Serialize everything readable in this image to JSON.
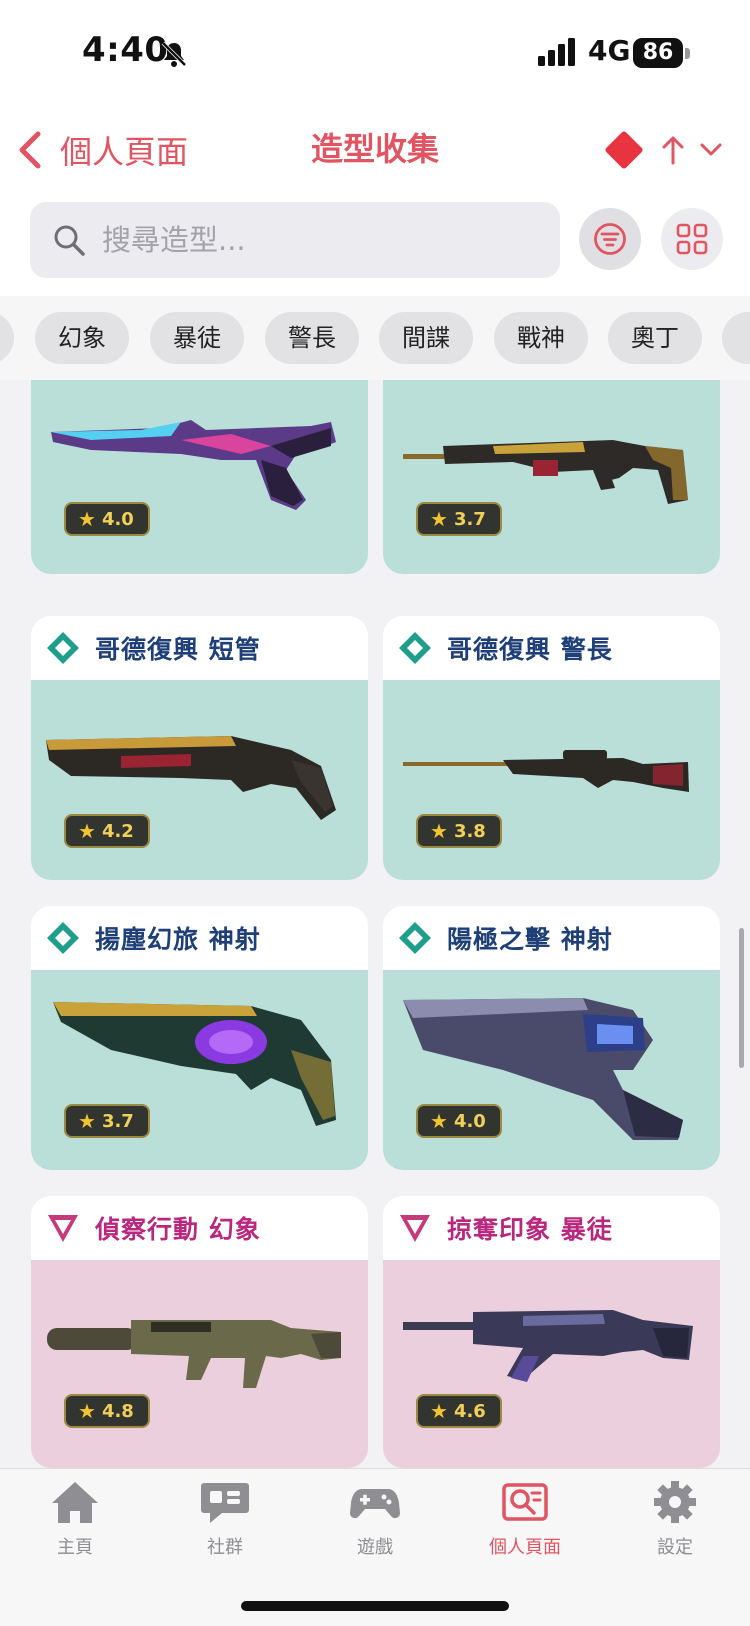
{
  "status_bar": {
    "time": "4:40",
    "network": "4G",
    "battery": "86"
  },
  "header": {
    "back_label": "個人頁面",
    "title": "造型收集"
  },
  "search": {
    "placeholder": "搜尋造型..."
  },
  "chips": [
    "幻象",
    "暴徒",
    "警長",
    "間諜",
    "戰神",
    "奧丁"
  ],
  "cards": [
    {
      "name": "",
      "rating": "4.0",
      "tier": "exclusive",
      "bg": "#b9dfd8"
    },
    {
      "name": "",
      "rating": "3.7",
      "tier": "exclusive",
      "bg": "#b9dfd8"
    },
    {
      "name": "哥德復興 短管",
      "rating": "4.2",
      "tier": "exclusive",
      "bg": "#b9dfd8"
    },
    {
      "name": "哥德復興 警長",
      "rating": "3.8",
      "tier": "exclusive",
      "bg": "#b9dfd8"
    },
    {
      "name": "揚塵幻旅 神射",
      "rating": "3.7",
      "tier": "exclusive",
      "bg": "#b9dfd8"
    },
    {
      "name": "陽極之擊 神射",
      "rating": "4.0",
      "tier": "exclusive",
      "bg": "#b9dfd8"
    },
    {
      "name": "偵察行動 幻象",
      "rating": "4.8",
      "tier": "premium",
      "bg": "#ebcfdc"
    },
    {
      "name": "掠奪印象 暴徒",
      "rating": "4.6",
      "tier": "premium",
      "bg": "#ebcfdc"
    }
  ],
  "colors": {
    "accent": "#e05561",
    "exclusive_name": "#1e3f78",
    "premium_name": "#b8287e"
  },
  "tabs": [
    {
      "label": "主頁",
      "icon": "home-icon",
      "active": false
    },
    {
      "label": "社群",
      "icon": "chat-icon",
      "active": false
    },
    {
      "label": "遊戲",
      "icon": "gamepad-icon",
      "active": false
    },
    {
      "label": "個人頁面",
      "icon": "profile-search-icon",
      "active": true
    },
    {
      "label": "設定",
      "icon": "gear-icon",
      "active": false
    }
  ]
}
